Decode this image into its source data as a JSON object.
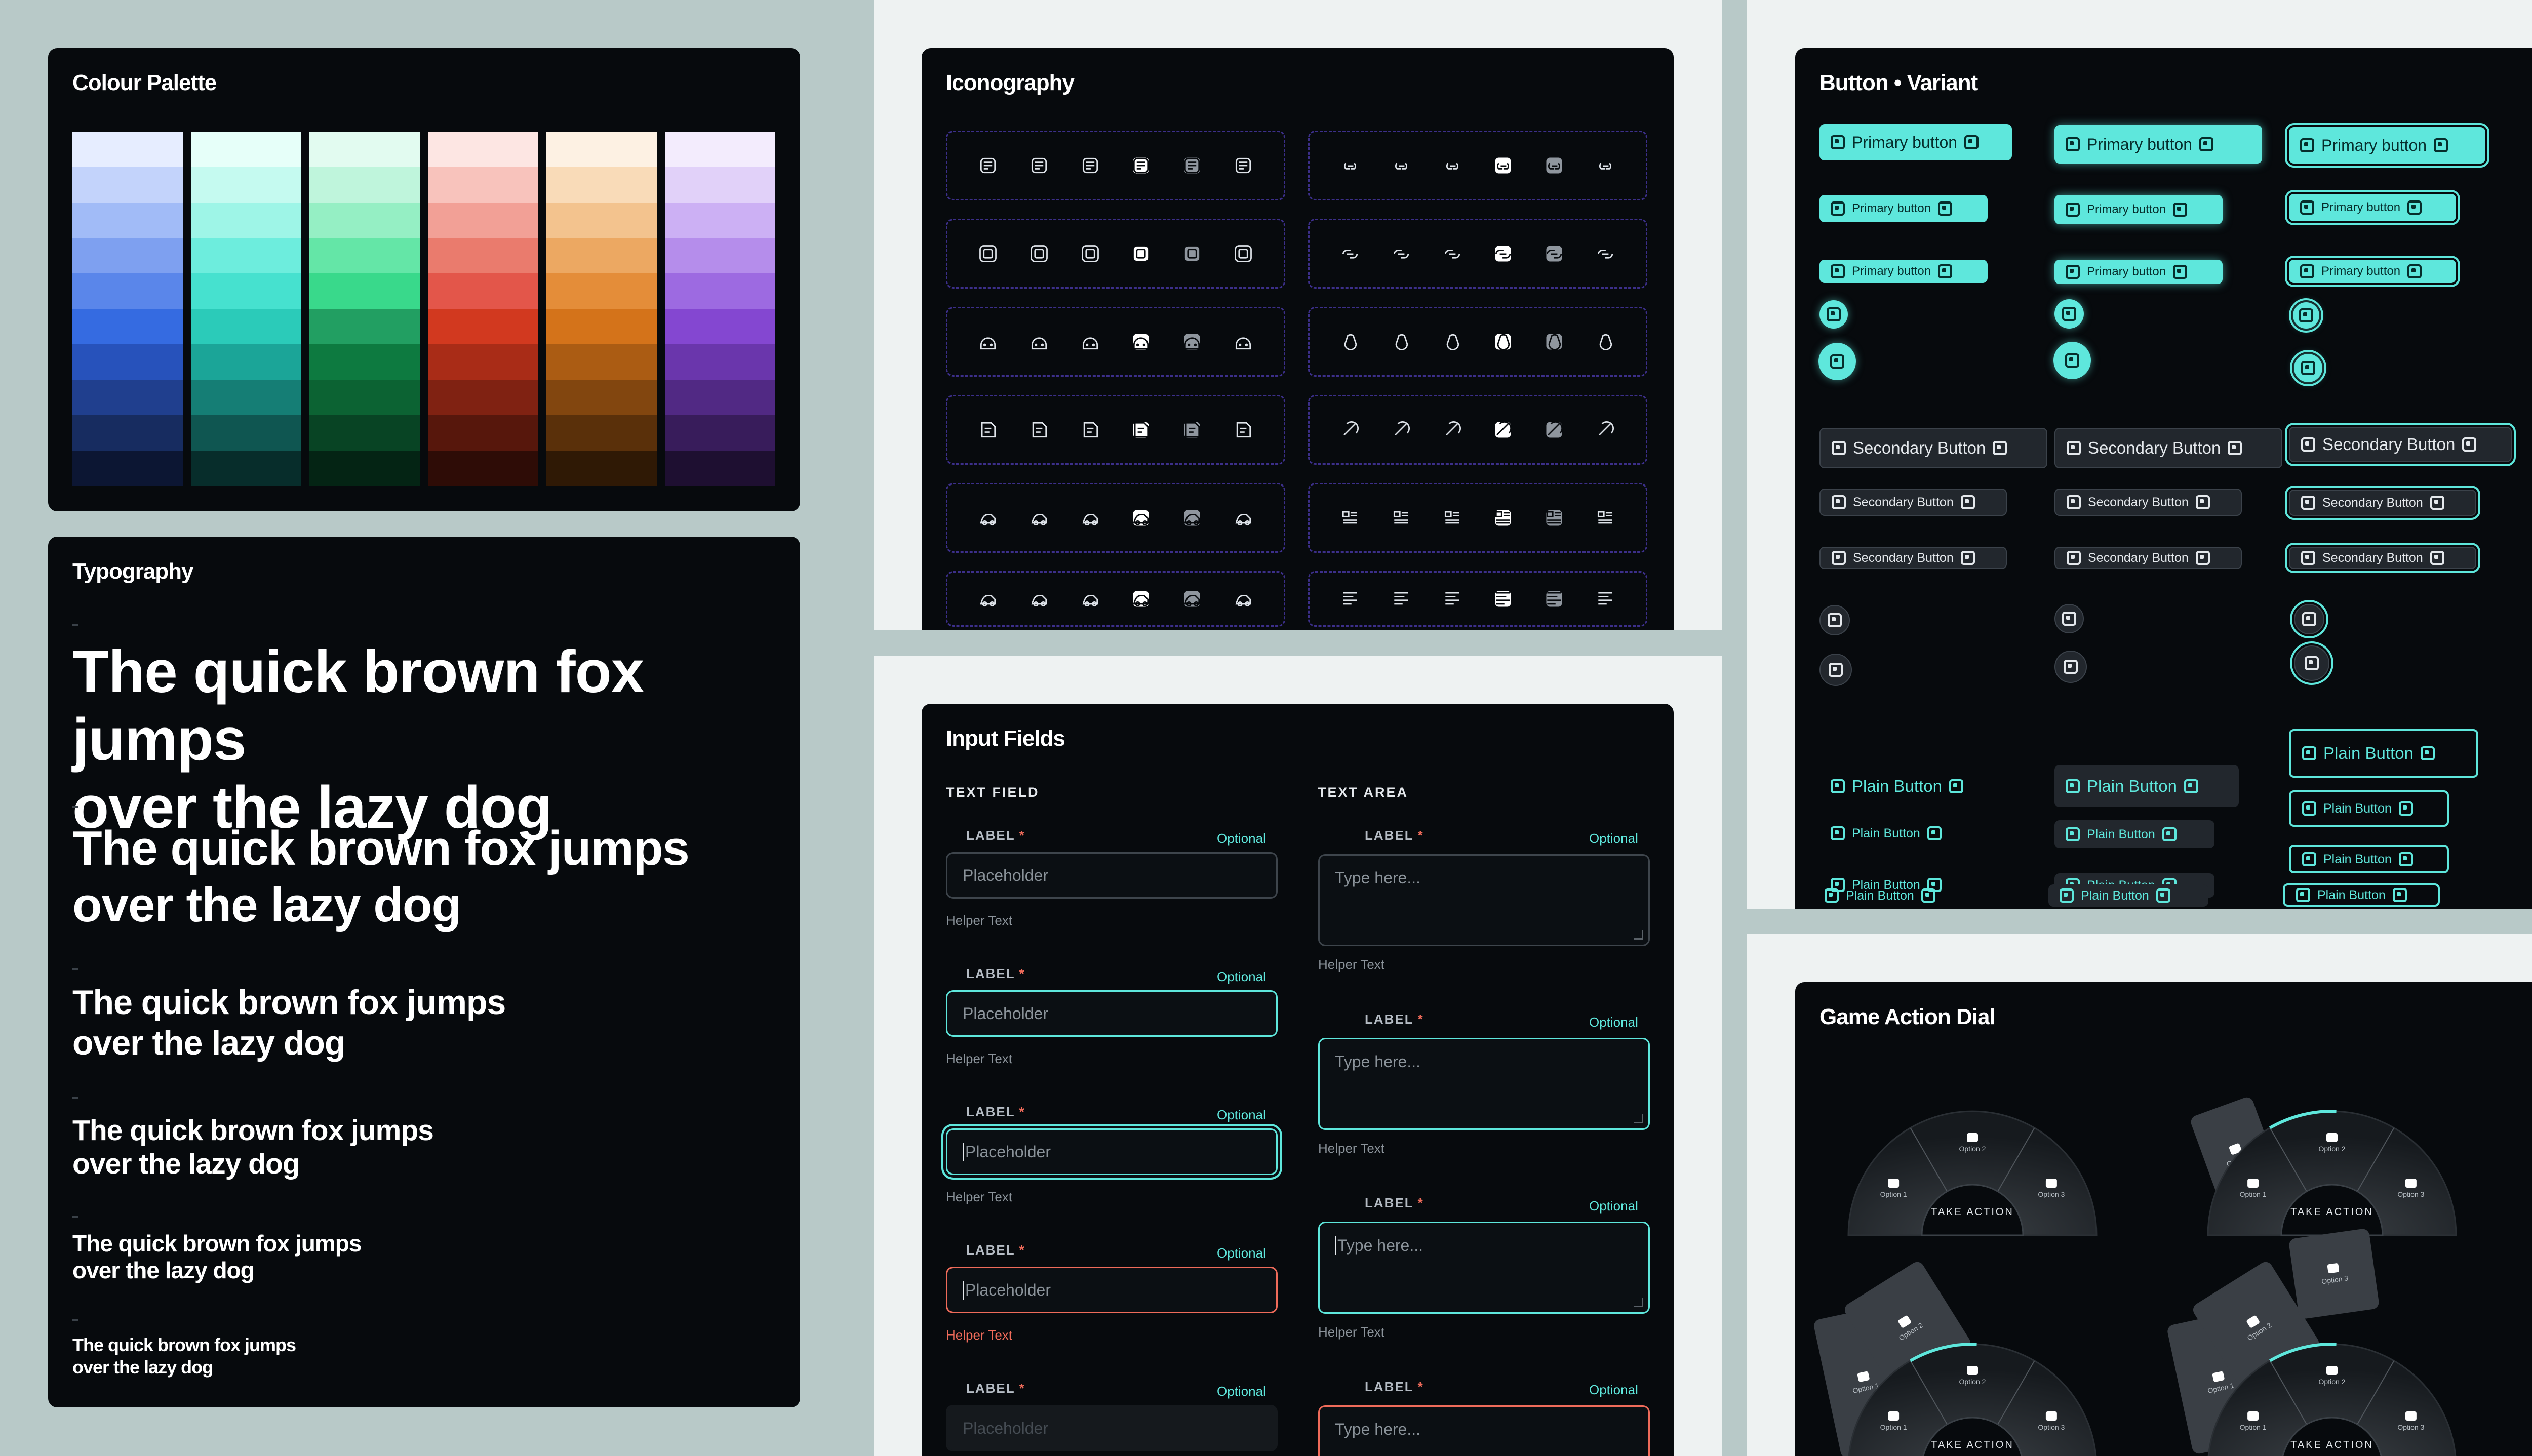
{
  "palette": {
    "title": "Colour Palette",
    "columns": [
      [
        "#e6edff",
        "#c3d3fb",
        "#a1bbf7",
        "#7ea0f0",
        "#5a86ea",
        "#356be1",
        "#2752bb",
        "#203f8e",
        "#172c60",
        "#0c1633"
      ],
      [
        "#e6fff9",
        "#c5faf0",
        "#9ef5e7",
        "#6deddd",
        "#46e1cf",
        "#2bcbb9",
        "#1ba598",
        "#157e75",
        "#0f5651",
        "#072d2b"
      ],
      [
        "#e2fbf0",
        "#bff5dc",
        "#95efc4",
        "#64e6a7",
        "#39d98b",
        "#229f62",
        "#0d7a40",
        "#0c6333",
        "#084424",
        "#042414"
      ],
      [
        "#fde6e3",
        "#f8c3bc",
        "#f2a096",
        "#ea7b6d",
        "#e3564a",
        "#d2391f",
        "#a92c17",
        "#802212",
        "#57170c",
        "#2e0c06"
      ],
      [
        "#fdf1e3",
        "#f9dbb8",
        "#f3c38e",
        "#eca862",
        "#e48d39",
        "#d4731a",
        "#ab5c13",
        "#82460f",
        "#5a300a",
        "#2f1905"
      ],
      [
        "#f3ecfd",
        "#e1d1f9",
        "#ccb0f4",
        "#b58deb",
        "#9d6ae1",
        "#8447d1",
        "#6a36ac",
        "#512984",
        "#381c5b",
        "#1e0f31"
      ]
    ]
  },
  "typography": {
    "title": "Typography",
    "sample": "The quick brown fox jumps over the lazy dog",
    "line1": "The quick brown fox jumps",
    "line2": "over the lazy dog"
  },
  "iconography": {
    "title": "Iconography"
  },
  "buttons": {
    "title": "Button • Variant",
    "primary": "Primary button",
    "secondary": "Secondary Button",
    "plain": "Plain Button"
  },
  "inputs": {
    "title": "Input Fields",
    "text_field": "TEXT FIELD",
    "text_area": "TEXT AREA",
    "label": "LABEL",
    "required": "*",
    "optional": "Optional",
    "placeholder": "Placeholder",
    "area_placeholder": "Type here...",
    "helper": "Helper Text"
  },
  "dial": {
    "title": "Game Action Dial",
    "take_action": "TAKE ACTION",
    "option1": "Option 1",
    "option2": "Option 2",
    "option3": "Option 3"
  },
  "colors": {
    "accent": "#5ee7dc",
    "error": "#ef6b5a",
    "card_bg": "#070a0d",
    "page_bg": "#b8c9c8"
  }
}
